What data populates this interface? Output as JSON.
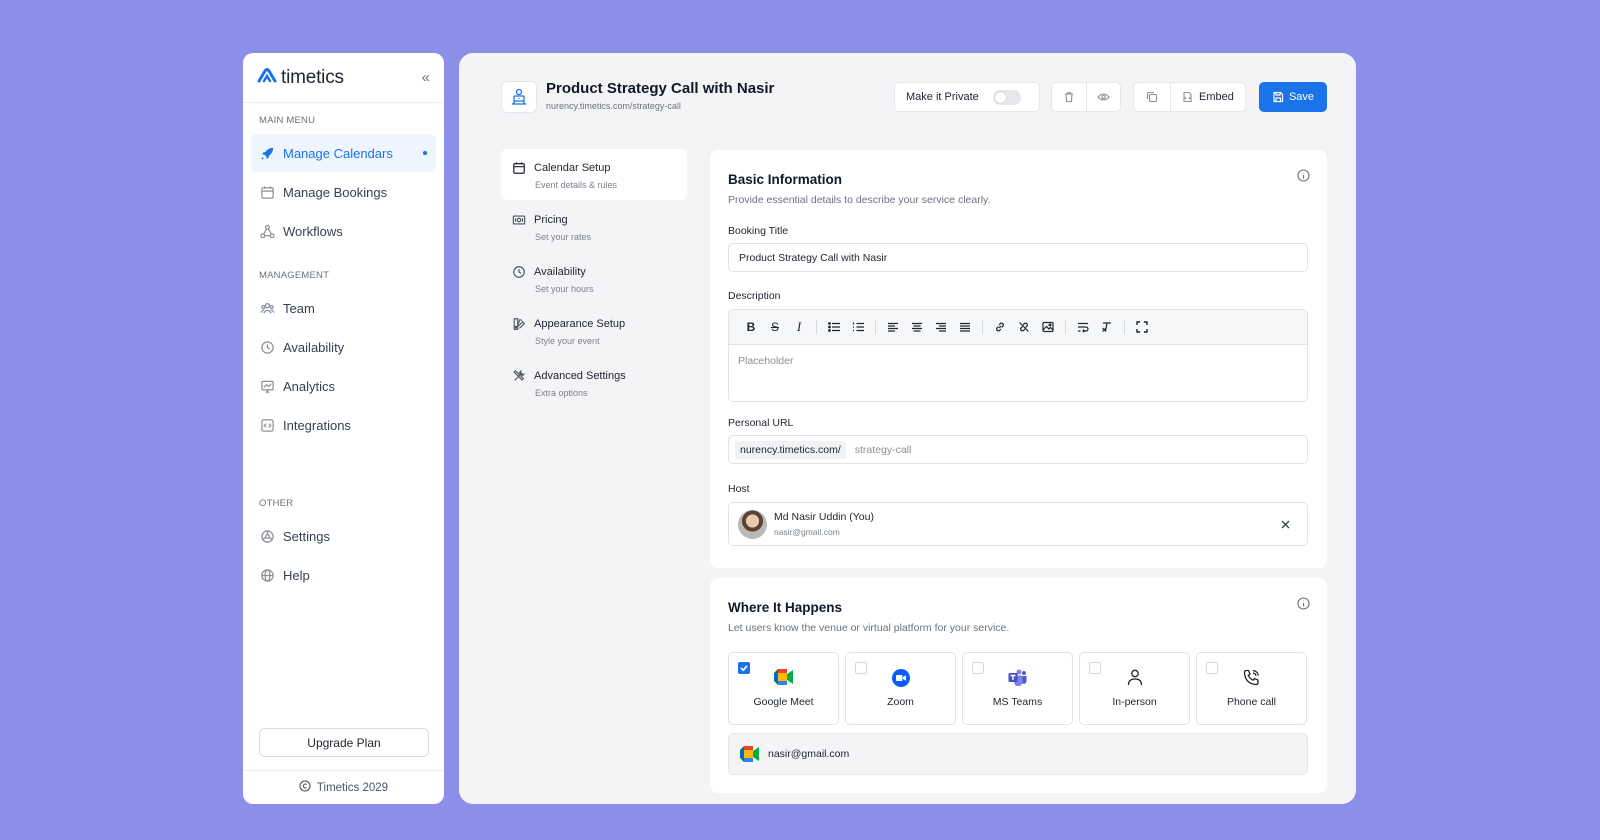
{
  "colors": {
    "background": "#8b8fe8",
    "accent": "#1a73e8",
    "panel": "#f4f4f6"
  },
  "sidebar": {
    "logo": "timetics",
    "collapse_icon": "chevrons-left-icon",
    "sections": {
      "main": "MAIN MENU",
      "management": "MANAGEMENT",
      "other": "OTHER"
    },
    "items": [
      {
        "label": "Manage Calendars",
        "icon": "rocket-icon",
        "active": true
      },
      {
        "label": "Manage Bookings",
        "icon": "calendar-icon"
      },
      {
        "label": "Workflows",
        "icon": "workflow-icon"
      },
      {
        "label": "Team",
        "icon": "team-icon"
      },
      {
        "label": "Availability",
        "icon": "clock-icon"
      },
      {
        "label": "Analytics",
        "icon": "chart-icon"
      },
      {
        "label": "Integrations",
        "icon": "code-icon"
      },
      {
        "label": "Settings",
        "icon": "settings-icon"
      },
      {
        "label": "Help",
        "icon": "globe-icon"
      }
    ],
    "upgrade": "Upgrade Plan",
    "footer": "Timetics 2029"
  },
  "header": {
    "title": "Product Strategy Call with Nasir",
    "url": "nurency.timetics.com/strategy-call",
    "private_label": "Make it Private",
    "private_on": false,
    "embed_label": "Embed",
    "save_label": "Save"
  },
  "steps": [
    {
      "title": "Calendar Setup",
      "sub": "Event details & rules",
      "icon": "calendar-icon",
      "active": true
    },
    {
      "title": "Pricing",
      "sub": "Set your rates",
      "icon": "money-icon"
    },
    {
      "title": "Availability",
      "sub": "Set your hours",
      "icon": "clock-icon"
    },
    {
      "title": "Appearance Setup",
      "sub": "Style your event",
      "icon": "palette-icon"
    },
    {
      "title": "Advanced Settings",
      "sub": "Extra options",
      "icon": "tools-icon"
    }
  ],
  "basic": {
    "title": "Basic Information",
    "subtitle": "Provide essential details to describe your service clearly.",
    "booking_title_label": "Booking Title",
    "booking_title_value": "Product Strategy Call with Nasir",
    "description_label": "Description",
    "description_placeholder": "Placeholder",
    "personal_url_label": "Personal URL",
    "url_prefix": "nurency.timetics.com/",
    "url_slug": "strategy-call",
    "host_label": "Host",
    "host_name": "Md Nasir Uddin (You)",
    "host_email": "nasir@gmail.com"
  },
  "where": {
    "title": "Where It Happens",
    "subtitle": "Let users know the venue or virtual platform for your service.",
    "options": [
      {
        "label": "Google Meet",
        "checked": true
      },
      {
        "label": "Zoom",
        "checked": false
      },
      {
        "label": "MS Teams",
        "checked": false
      },
      {
        "label": "In-person",
        "checked": false
      },
      {
        "label": "Phone call",
        "checked": false
      }
    ],
    "meet_email": "nasir@gmail.com"
  }
}
